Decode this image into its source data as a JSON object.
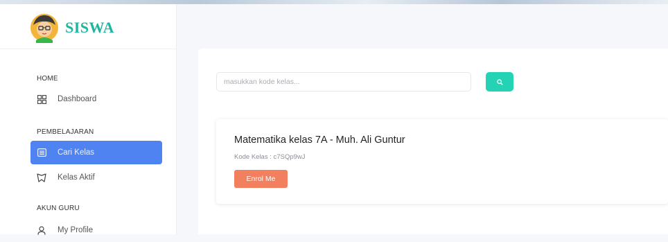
{
  "brand": {
    "name": "SISWA"
  },
  "sidebar": {
    "sections": [
      {
        "title": "HOME",
        "items": [
          {
            "label": "Dashboard",
            "icon": "dashboard-grid-icon"
          }
        ]
      },
      {
        "title": "PEMBELAJARAN",
        "items": [
          {
            "label": "Cari Kelas",
            "icon": "list-icon",
            "active": true
          },
          {
            "label": "Kelas Aktif",
            "icon": "badge-icon"
          }
        ]
      },
      {
        "title": "AKUN GURU",
        "items": [
          {
            "label": "My Profile",
            "icon": "user-icon"
          }
        ]
      }
    ]
  },
  "search": {
    "placeholder": "masukkan kode kelas...",
    "value": "",
    "button_icon": "search-icon"
  },
  "results": [
    {
      "title": "Matematika kelas 7A - Muh. Ali Guntur",
      "code_text": "Kode Kelas : c7SQp9wJ",
      "button_label": "Enrol Me"
    }
  ],
  "colors": {
    "brand": "#1eb6a0",
    "active_nav": "#4f83f1",
    "search_button": "#24d3b4",
    "enroll_button": "#f2805e"
  }
}
